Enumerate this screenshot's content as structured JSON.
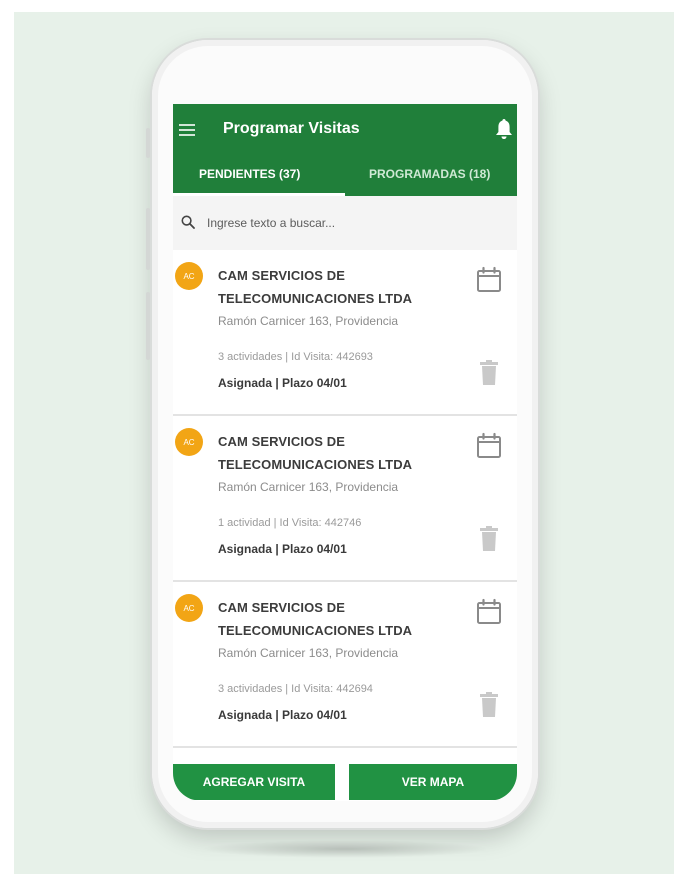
{
  "header": {
    "title": "Programar Visitas",
    "tabs": [
      {
        "label": "PENDIENTES (37)",
        "active": true
      },
      {
        "label": "PROGRAMADAS (18)",
        "active": false
      }
    ]
  },
  "search": {
    "placeholder": "Ingrese texto a buscar..."
  },
  "visits": [
    {
      "avatar": "AC",
      "company_line1": "CAM SERVICIOS DE",
      "company_line2": "TELECOMUNICACIONES LTDA",
      "address": "Ramón Carnicer 163, Providencia",
      "meta": "3 actividades | Id Visita: 442693",
      "status": "Asignada | Plazo 04/01"
    },
    {
      "avatar": "AC",
      "company_line1": "CAM SERVICIOS DE",
      "company_line2": "TELECOMUNICACIONES LTDA",
      "address": "Ramón Carnicer 163, Providencia",
      "meta": "1 actividad | Id Visita: 442746",
      "status": "Asignada | Plazo 04/01"
    },
    {
      "avatar": "AC",
      "company_line1": "CAM SERVICIOS DE",
      "company_line2": "TELECOMUNICACIONES LTDA",
      "address": "Ramón Carnicer 163, Providencia",
      "meta": "3 actividades | Id Visita: 442694",
      "status": "Asignada | Plazo 04/01"
    }
  ],
  "footer": {
    "add_label": "AGREGAR VISITA",
    "map_label": "VER MAPA"
  },
  "icons": {
    "menu": "menu-icon",
    "bell": "bell-icon",
    "search": "search-icon",
    "calendar": "calendar-icon",
    "trash": "trash-icon"
  },
  "colors": {
    "primary": "#207f3a",
    "button": "#219243",
    "avatar": "#f2a515",
    "background": "#e7f1e9"
  }
}
